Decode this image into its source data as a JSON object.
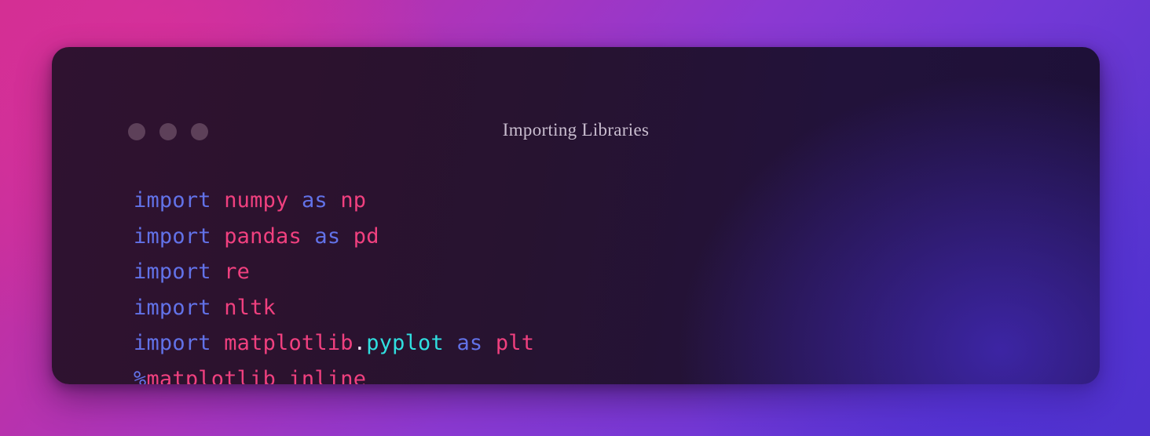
{
  "window": {
    "title": "Importing Libraries",
    "traffic_lights": [
      {
        "name": "close-dot",
        "color": "#5d4059"
      },
      {
        "name": "minimize-dot",
        "color": "#5d4059"
      },
      {
        "name": "maximize-dot",
        "color": "#5d4059"
      }
    ]
  },
  "theme": {
    "background_start": "#cf2f92",
    "background_mid": "#8c39d2",
    "background_end": "#5234c9",
    "card_background_start": "#2f1230",
    "card_background_end": "#1d1038",
    "title_color": "#c9bdcf",
    "keyword_color": "#6272e8",
    "module_color": "#f0407f",
    "attribute_color": "#30dfe0",
    "punctuation_color": "#e8e0f0"
  },
  "code": {
    "language": "python",
    "lines": [
      {
        "index": 1,
        "text": "import numpy as np",
        "tokens": [
          {
            "t": "import",
            "k": "kw"
          },
          {
            "t": " ",
            "k": "plainspace"
          },
          {
            "t": "numpy",
            "k": "mod"
          },
          {
            "t": " ",
            "k": "plainspace"
          },
          {
            "t": "as",
            "k": "kw"
          },
          {
            "t": " ",
            "k": "plainspace"
          },
          {
            "t": "np",
            "k": "mod"
          }
        ]
      },
      {
        "index": 2,
        "text": "import pandas as pd",
        "tokens": [
          {
            "t": "import",
            "k": "kw"
          },
          {
            "t": " ",
            "k": "plainspace"
          },
          {
            "t": "pandas",
            "k": "mod"
          },
          {
            "t": " ",
            "k": "plainspace"
          },
          {
            "t": "as",
            "k": "kw"
          },
          {
            "t": " ",
            "k": "plainspace"
          },
          {
            "t": "pd",
            "k": "mod"
          }
        ]
      },
      {
        "index": 3,
        "text": "import re",
        "tokens": [
          {
            "t": "import",
            "k": "kw"
          },
          {
            "t": " ",
            "k": "plainspace"
          },
          {
            "t": "re",
            "k": "mod"
          }
        ]
      },
      {
        "index": 4,
        "text": "import nltk",
        "tokens": [
          {
            "t": "import",
            "k": "kw"
          },
          {
            "t": " ",
            "k": "plainspace"
          },
          {
            "t": "nltk",
            "k": "mod"
          }
        ]
      },
      {
        "index": 5,
        "text": "import matplotlib.pyplot as plt",
        "tokens": [
          {
            "t": "import",
            "k": "kw"
          },
          {
            "t": " ",
            "k": "plainspace"
          },
          {
            "t": "matplotlib",
            "k": "mod"
          },
          {
            "t": ".",
            "k": "dot"
          },
          {
            "t": "pyplot",
            "k": "attr"
          },
          {
            "t": " ",
            "k": "plainspace"
          },
          {
            "t": "as",
            "k": "kw"
          },
          {
            "t": " ",
            "k": "plainspace"
          },
          {
            "t": "plt",
            "k": "mod"
          }
        ]
      },
      {
        "index": 6,
        "text": "%matplotlib inline",
        "tokens": [
          {
            "t": "%",
            "k": "op"
          },
          {
            "t": "matplotlib inline",
            "k": "plain"
          }
        ]
      }
    ]
  }
}
